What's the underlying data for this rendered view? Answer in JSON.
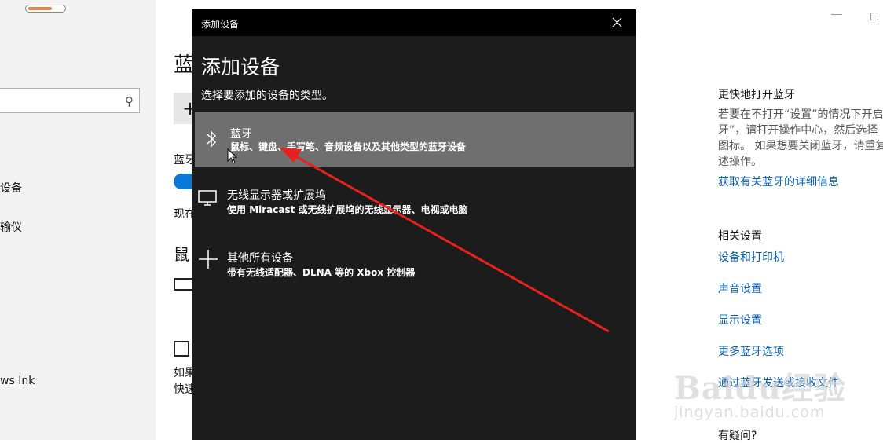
{
  "sidebar": {
    "items": [
      {
        "label": "设备"
      },
      {
        "label": "输仪"
      },
      {
        "label": "ws Ink"
      }
    ]
  },
  "page": {
    "title": "蓝",
    "add_button_label": "+",
    "bluetooth_label": "蓝牙",
    "now_text": "现在",
    "mouse_heading": "鼠",
    "checkbox_text_1": "如果",
    "checkbox_text_2": "快速"
  },
  "dialog": {
    "window_title": "添加设备",
    "heading": "添加设备",
    "subtitle": "选择要添加的设备的类型。",
    "options": [
      {
        "title": "蓝牙",
        "description": "鼠标、键盘、手写笔、音频设备以及其他类型的蓝牙设备",
        "icon": "bluetooth-icon"
      },
      {
        "title": "无线显示器或扩展坞",
        "description": "使用 Miracast 或无线扩展坞的无线显示器、电视或电脑",
        "icon": "monitor-icon"
      },
      {
        "title": "其他所有设备",
        "description": "带有无线适配器、DLNA 等的 Xbox 控制器",
        "icon": "plus-icon"
      }
    ]
  },
  "right_panel": {
    "faster_heading": "更快地打开蓝牙",
    "faster_text_lines": [
      "若要在不打开“设置”的情况下开启",
      "牙”，请打开操作中心，然后选择",
      "图标。 如果想要关闭蓝牙，请重复",
      "述操作。"
    ],
    "bluetooth_info_link": "获取有关蓝牙的详细信息",
    "related_heading": "相关设置",
    "links": [
      "设备和打印机",
      "声音设置",
      "显示设置",
      "更多蓝牙选项",
      "通过蓝牙发送或接收文件"
    ],
    "help_heading": "有疑问?"
  },
  "watermark": {
    "text": "Baidu经验",
    "url_text": "jingyan.baidu.com"
  },
  "colors": {
    "accent": "#0a78d7",
    "link": "#0a5fb4",
    "dialog_bg": "#1c1c1c",
    "selected_option": "#6f6f6f",
    "arrow": "#e8211c"
  }
}
